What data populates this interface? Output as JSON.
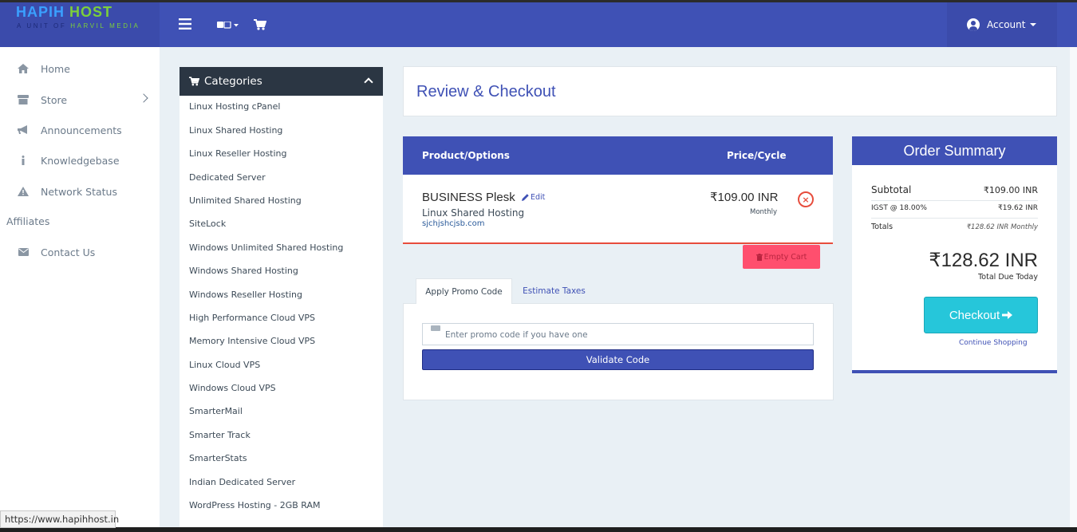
{
  "logo": {
    "title_part1": "HAPIH ",
    "title_part2": "HOST",
    "subtitle_part1": "A UNIT OF ",
    "subtitle_part2": "HARVIL MEDIA"
  },
  "topbar": {
    "account_label": "Account"
  },
  "sidebar": {
    "items": [
      {
        "label": "Home",
        "icon": "home-icon"
      },
      {
        "label": "Store",
        "icon": "store-icon"
      },
      {
        "label": "Announcements",
        "icon": "megaphone-icon"
      },
      {
        "label": "Knowledgebase",
        "icon": "info-icon"
      },
      {
        "label": "Network Status",
        "icon": "warning-icon"
      }
    ],
    "section_header": "Affiliates",
    "contact": {
      "label": "Contact Us",
      "icon": "envelope-icon"
    }
  },
  "categories": {
    "title": "Categories",
    "items": [
      "Linux Hosting cPanel",
      "Linux Shared Hosting",
      "Linux Reseller Hosting",
      "Dedicated Server",
      "Unlimited Shared Hosting",
      "SiteLock",
      "Windows Unlimited Shared Hosting",
      "Windows Shared Hosting",
      "Windows Reseller Hosting",
      "High Performance Cloud VPS",
      "Memory Intensive Cloud VPS",
      "Linux Cloud VPS",
      "Windows Cloud VPS",
      "SmarterMail",
      "Smarter Track",
      "SmarterStats",
      "Indian Dedicated Server",
      "WordPress Hosting - 2GB RAM"
    ]
  },
  "page": {
    "title": "Review & Checkout"
  },
  "cart": {
    "col_product": "Product/Options",
    "col_price": "Price/Cycle",
    "item": {
      "name": "BUSINESS Plesk",
      "edit_label": "Edit",
      "group": "Linux Shared Hosting",
      "domain": "sjchjshcjsb.com",
      "price": "₹109.00 INR",
      "cycle": "Monthly"
    },
    "empty_label": "Empty Cart"
  },
  "tabs": {
    "promo": "Apply Promo Code",
    "taxes": "Estimate Taxes"
  },
  "promo": {
    "placeholder": "Enter promo code if you have one",
    "validate_label": "Validate Code"
  },
  "summary": {
    "title": "Order Summary",
    "subtotal_label": "Subtotal",
    "subtotal_value": "₹109.00 INR",
    "tax_label": "IGST @ 18.00%",
    "tax_value": "₹19.62 INR",
    "totals_label": "Totals",
    "totals_value": "₹128.62 INR Monthly",
    "total_due": "₹128.62 INR",
    "total_due_label": "Total Due Today",
    "checkout_label": "Checkout",
    "continue_label": "Continue Shopping"
  },
  "status_url": "https://www.hapihhost.in",
  "colors": {
    "primary": "#3f51b5",
    "dark": "#2b3643",
    "danger": "#e74c3c",
    "accent": "#26c6da",
    "empty_cart": "#ff4f6e"
  }
}
